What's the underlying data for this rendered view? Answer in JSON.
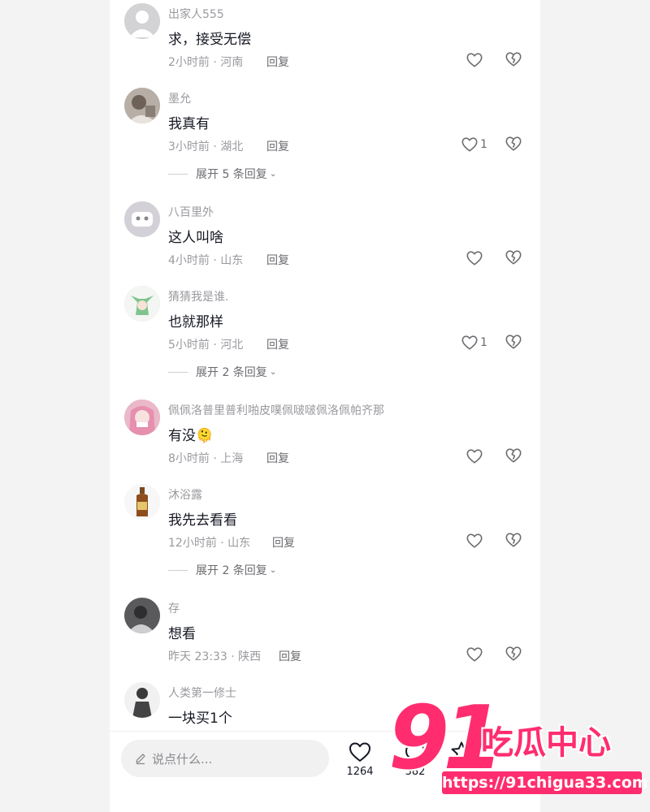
{
  "comments": [
    {
      "username": "出家人555",
      "text": "求，接受无偿",
      "time": "2小时前 · 河南",
      "reply": "回复",
      "likes": ""
    },
    {
      "username": "墨允",
      "text": "我真有",
      "time": "3小时前 · 湖北",
      "reply": "回复",
      "likes": "1",
      "expand": "展开 5 条回复"
    },
    {
      "username": "八百里外",
      "text": "这人叫啥",
      "time": "4小时前 · 山东",
      "reply": "回复",
      "likes": ""
    },
    {
      "username": "猜猜我是谁.",
      "text": "也就那样",
      "time": "5小时前 · 河北",
      "reply": "回复",
      "likes": "1",
      "expand": "展开 2 条回复"
    },
    {
      "username": "佩佩洛普里普利啪皮噗佩啵啵佩洛佩帕齐那",
      "text": "有没",
      "emoji": "🫠",
      "time": "8小时前 · 上海",
      "reply": "回复",
      "likes": ""
    },
    {
      "username": "沐浴露",
      "text": "我先去看看",
      "time": "12小时前 · 山东",
      "reply": "回复",
      "likes": "",
      "expand": "展开 2 条回复"
    },
    {
      "username": "存",
      "text": "想看",
      "time": "昨天 23:33 · 陕西",
      "reply": "回复",
      "likes": ""
    },
    {
      "username": "人类第一修士",
      "text": "一块买1个"
    }
  ],
  "bottom_bar": {
    "input_placeholder": "说点什么...",
    "like_count": "1264",
    "comment_count": "382"
  },
  "watermark": {
    "number": "91",
    "brand": "吃瓜中心",
    "url": "https://91chigua33.com"
  },
  "colors": {
    "accent": "#ff2d6f",
    "text": "#161823",
    "muted": "#9a9a9f"
  },
  "icons": [
    "heart-icon",
    "broken-heart-icon",
    "pencil-icon",
    "comment-bubble-icon",
    "star-icon"
  ]
}
